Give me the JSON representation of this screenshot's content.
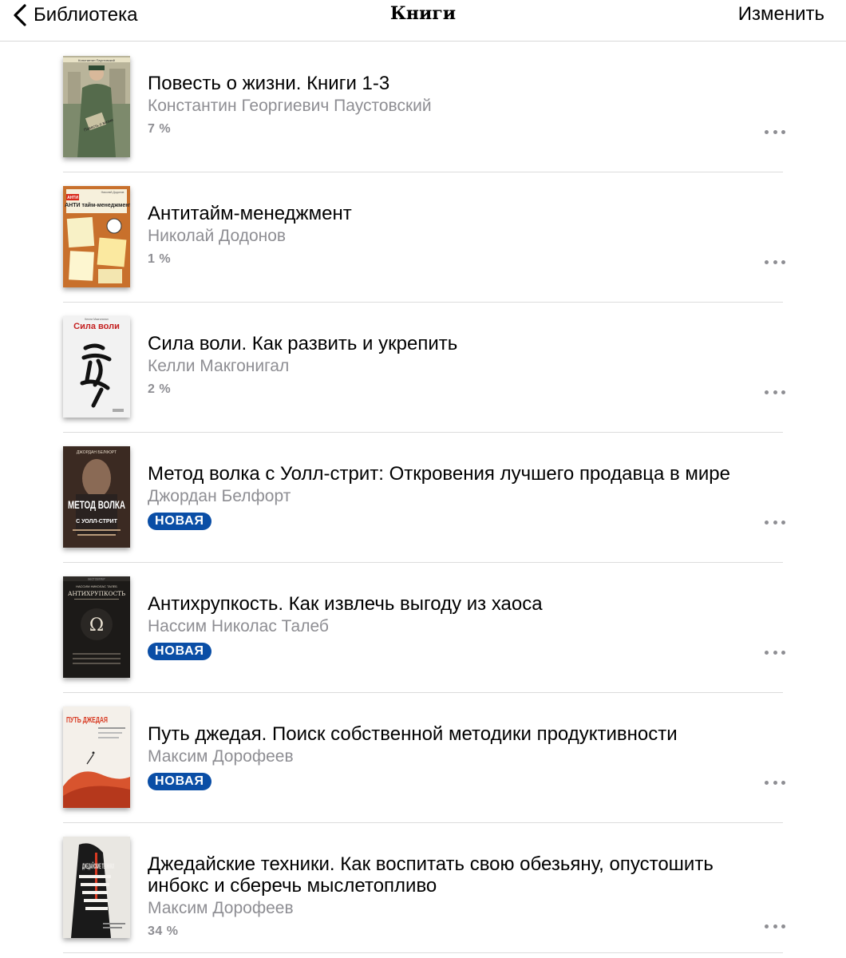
{
  "nav": {
    "back_label": "Библиотека",
    "title": "Книги",
    "edit_label": "Изменить"
  },
  "books": [
    {
      "title": "Повесть о жизни. Книги 1-3",
      "author": "Константин Георгиевич Паустовский",
      "progress": "7 %",
      "badge": null,
      "cover": {
        "title_text": "Повесть о жизни",
        "top_text": "Константин Паустовский",
        "bg": "#7d8a6c"
      }
    },
    {
      "title": "Антитайм-менеджмент",
      "author": "Николай Додонов",
      "progress": "1 %",
      "badge": null,
      "cover": {
        "title_text": "АНТИ тайм-менеджмент",
        "top_text": "Николай Додонов",
        "bg": "#c8702c"
      }
    },
    {
      "title": "Сила воли. Как развить и укрепить",
      "author": "Келли Макгонигал",
      "progress": "2 %",
      "badge": null,
      "cover": {
        "title_text": "Сила воли",
        "top_text": "Келли Макгонигал",
        "bg": "#f2f2f2"
      }
    },
    {
      "title": "Метод волка с Уолл-стрит: Откровения лучшего продавца в мире",
      "author": "Джордан Белфорт",
      "progress": null,
      "badge": "НОВАЯ",
      "cover": {
        "title_text": "МЕТОД ВОЛКА",
        "sub_text": "С УОЛЛ-СТРИТ",
        "top_text": "ДЖОРДАН БЕЛФОРТ",
        "bg": "#5a3a28"
      }
    },
    {
      "title": "Антихрупкость. Как извлечь выгоду из хаоса",
      "author": "Нассим Николас Талеб",
      "progress": null,
      "badge": "НОВАЯ",
      "cover": {
        "title_text": "АНТИХРУПКОСТЬ",
        "top_text": "НАССИМ НИКОЛАС ТАЛЕБ",
        "bg": "#1c1a18"
      }
    },
    {
      "title": "Путь джедая. Поиск собственной методики продуктивности",
      "author": "Максим Дорофеев",
      "progress": null,
      "badge": "НОВАЯ",
      "cover": {
        "title_text": "ПУТЬ ДЖЕДАЯ",
        "top_text": "",
        "bg": "#f4f0ea"
      }
    },
    {
      "title": "Джедайские техники. Как воспитать свою обезьяну, опустошить инбокс и сберечь мыслетопливо",
      "author": "Максим Дорофеев",
      "progress": "34 %",
      "badge": null,
      "cover": {
        "title_text": "ДЖЕДАЙСКИЕ ТЕХНИКИ",
        "top_text": "",
        "bg": "#e9e7e2"
      }
    }
  ],
  "colors": {
    "badge_bg": "#0a4ea6",
    "secondary_text": "#8e8e93",
    "separator": "#dcdcdc"
  },
  "icons": {
    "back": "chevron-left-icon",
    "more": "more-horizontal-icon"
  }
}
